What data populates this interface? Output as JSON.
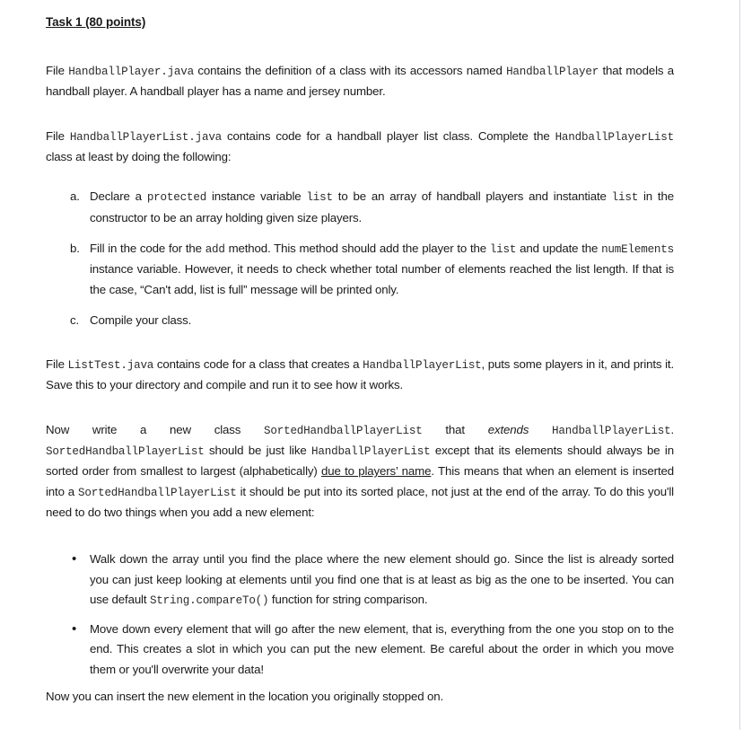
{
  "document": {
    "title": "Task 1 (80 points)",
    "paragraph_1": {
      "seg_1": "File ",
      "code_1": "HandballPlayer.java",
      "seg_2": "  contains the definition of a class with its accessors named ",
      "code_2": "HandballPlayer",
      "seg_3": " that models a handball player. A handball player has a name and jersey number."
    },
    "paragraph_2": {
      "seg_1": "File ",
      "code_1": "HandballPlayerList.java",
      "seg_2": "  contains code for a handball player list class. Complete the ",
      "code_2": "HandballPlayerList",
      "seg_3": " class at least by doing the following:"
    },
    "alpha_list": {
      "item_a": {
        "marker": "a.",
        "seg_1": "Declare a ",
        "code_1": "protected",
        "seg_2": " instance variable ",
        "code_2": "list",
        "seg_3": " to be an array of handball players and instantiate ",
        "code_3": "list",
        "seg_4": " in the constructor to be an array holding given size players."
      },
      "item_b": {
        "marker": "b.",
        "seg_1": "Fill in the code for the ",
        "code_1": "add",
        "seg_2": " method. This method should add the player to the ",
        "code_2": "list",
        "seg_3": " and update the ",
        "code_3": "numElements",
        "seg_4": " instance variable. However, it needs to check whether total number of elements reached the list length. If that is the case, “Can't add, list is full” message will be printed only."
      },
      "item_c": {
        "marker": "c.",
        "text": "Compile your class."
      }
    },
    "paragraph_3": {
      "seg_1": "File ",
      "code_1": "ListTest.java",
      "seg_2": "  contains code for a class that creates a ",
      "code_2": "HandballPlayerList",
      "seg_3": ", puts some players in it, and prints it. Save this to your directory and compile and run it to see how it works."
    },
    "paragraph_4": {
      "seg_1": "Now write a new class ",
      "code_1": "SortedHandballPlayerList",
      "seg_2": " that ",
      "italic_1": "extends",
      "seg_3": " ",
      "code_2": "HandballPlayerList",
      "seg_4": ". ",
      "code_3": "SortedHandballPlayerList",
      "seg_5": " should be just like ",
      "code_4": "HandballPlayerList",
      "seg_6": " except that its elements should always be in sorted order from smallest to largest (alphabetically) ",
      "underline_1": "due to players’ name",
      "seg_7": ". This means that when an element is inserted into a ",
      "code_5": "SortedHandballPlayerList",
      "seg_8": " it should be put into its sorted place, not just at the end of the array. To do this you'll need to do two things when you add a new element:"
    },
    "bullet_list": {
      "bullet_char": "•",
      "item_1": {
        "seg_1": "Walk down the array until you find the place where the new element should go. Since the list is already sorted you can just keep looking at elements until you find one that is at least as big as the one to be inserted. You can use default ",
        "code_1": "String.compareTo()",
        "seg_2": " function for string comparison."
      },
      "item_2": {
        "text": "Move down every element that will go after the new element, that is, everything from the one you stop on to the end. This creates a slot in which you can put the new element. Be careful about the order in which you move them or you'll overwrite your data!"
      }
    },
    "closing_paragraph": "Now you can insert the new element in the location you originally stopped on."
  },
  "colors": {
    "page_background": "#ffffff",
    "body_text": "#1a1a1a",
    "code_text": "#2b2b2b",
    "page_edge": "#d6d6dd"
  }
}
